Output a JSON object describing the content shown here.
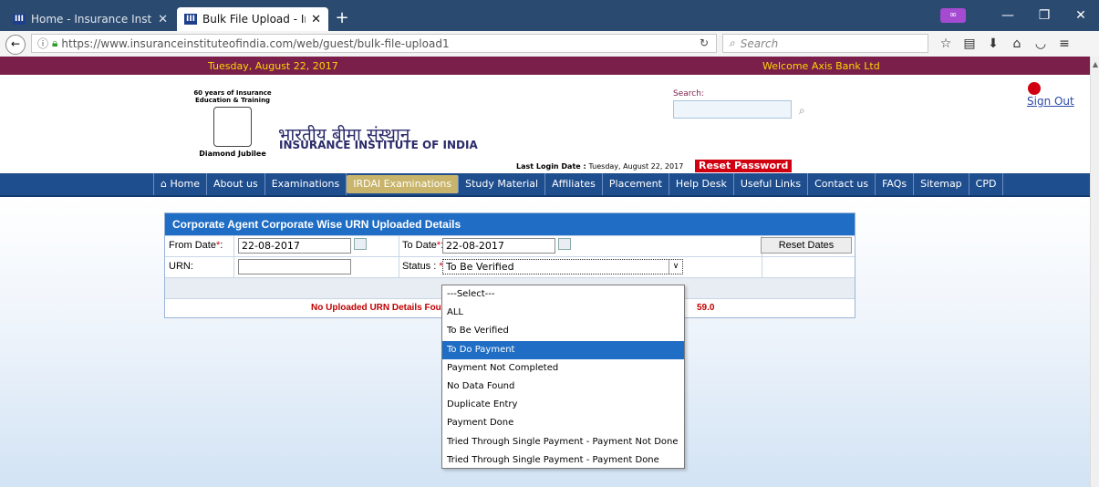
{
  "browser": {
    "tabs": [
      {
        "title": "Home - Insurance Institute o",
        "icon": "page-icon"
      },
      {
        "title": "Bulk File Upload - Insurance",
        "icon": "page-icon"
      }
    ],
    "url": "https://www.insuranceinstituteofindia.com/web/guest/bulk-file-upload1",
    "search_placeholder": "Search"
  },
  "topbar": {
    "date": "Tuesday, August 22, 2017",
    "welcome": "Welcome Axis Bank Ltd"
  },
  "header": {
    "logo_line1": "60 years of Insurance",
    "logo_line2": "Education & Training",
    "logo_jubilee": "Diamond Jubilee",
    "title_hindi": "भारतीय बीमा संस्थान",
    "title_english": "INSURANCE INSTITUTE OF INDIA",
    "search_label": "Search:",
    "sign_out": "Sign Out",
    "last_login_label": "Last Login Date :",
    "last_login_value": "Tuesday, August 22, 2017",
    "reset_password": "Reset Password"
  },
  "menu": [
    "Home",
    "About us",
    "Examinations",
    "IRDAI Examinations",
    "Study Material",
    "Affiliates",
    "Placement",
    "Help Desk",
    "Useful Links",
    "Contact us",
    "FAQs",
    "Sitemap",
    "CPD"
  ],
  "panel": {
    "title": "Corporate Agent Corporate Wise URN Uploaded Details",
    "from_label": "From Date",
    "from_value": "22-08-2017",
    "to_label": "To Date",
    "to_value": "22-08-2017",
    "reset_dates": "Reset Dates",
    "urn_label": "URN:",
    "urn_value": "",
    "status_label": "Status :",
    "status_value": "To Be Verified",
    "message_left": "No Uploaded URN Details Fou",
    "message_right": "59.0"
  },
  "status_options": [
    "---Select---",
    "ALL",
    "To Be Verified",
    "To Do Payment",
    "Payment Not Completed",
    "No Data Found",
    "Duplicate Entry",
    "Payment Done",
    "Tried Through Single Payment - Payment Not Done",
    "Tried Through Single Payment - Payment Done"
  ],
  "highlighted_option": "To Do Payment",
  "colors": {
    "brand_maroon": "#7a1f4a",
    "menu_blue": "#1f4e8f",
    "panel_blue": "#1f6dc4",
    "alert_red": "#d10010"
  }
}
